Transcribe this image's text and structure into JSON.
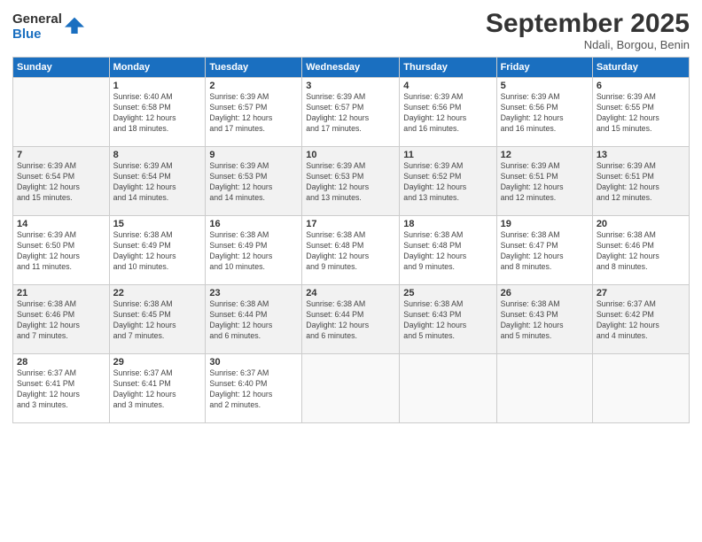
{
  "logo": {
    "general": "General",
    "blue": "Blue"
  },
  "header": {
    "month": "September 2025",
    "location": "Ndali, Borgou, Benin"
  },
  "weekdays": [
    "Sunday",
    "Monday",
    "Tuesday",
    "Wednesday",
    "Thursday",
    "Friday",
    "Saturday"
  ],
  "weeks": [
    [
      {
        "day": "",
        "info": ""
      },
      {
        "day": "1",
        "info": "Sunrise: 6:40 AM\nSunset: 6:58 PM\nDaylight: 12 hours\nand 18 minutes."
      },
      {
        "day": "2",
        "info": "Sunrise: 6:39 AM\nSunset: 6:57 PM\nDaylight: 12 hours\nand 17 minutes."
      },
      {
        "day": "3",
        "info": "Sunrise: 6:39 AM\nSunset: 6:57 PM\nDaylight: 12 hours\nand 17 minutes."
      },
      {
        "day": "4",
        "info": "Sunrise: 6:39 AM\nSunset: 6:56 PM\nDaylight: 12 hours\nand 16 minutes."
      },
      {
        "day": "5",
        "info": "Sunrise: 6:39 AM\nSunset: 6:56 PM\nDaylight: 12 hours\nand 16 minutes."
      },
      {
        "day": "6",
        "info": "Sunrise: 6:39 AM\nSunset: 6:55 PM\nDaylight: 12 hours\nand 15 minutes."
      }
    ],
    [
      {
        "day": "7",
        "info": "Sunrise: 6:39 AM\nSunset: 6:54 PM\nDaylight: 12 hours\nand 15 minutes."
      },
      {
        "day": "8",
        "info": "Sunrise: 6:39 AM\nSunset: 6:54 PM\nDaylight: 12 hours\nand 14 minutes."
      },
      {
        "day": "9",
        "info": "Sunrise: 6:39 AM\nSunset: 6:53 PM\nDaylight: 12 hours\nand 14 minutes."
      },
      {
        "day": "10",
        "info": "Sunrise: 6:39 AM\nSunset: 6:53 PM\nDaylight: 12 hours\nand 13 minutes."
      },
      {
        "day": "11",
        "info": "Sunrise: 6:39 AM\nSunset: 6:52 PM\nDaylight: 12 hours\nand 13 minutes."
      },
      {
        "day": "12",
        "info": "Sunrise: 6:39 AM\nSunset: 6:51 PM\nDaylight: 12 hours\nand 12 minutes."
      },
      {
        "day": "13",
        "info": "Sunrise: 6:39 AM\nSunset: 6:51 PM\nDaylight: 12 hours\nand 12 minutes."
      }
    ],
    [
      {
        "day": "14",
        "info": "Sunrise: 6:39 AM\nSunset: 6:50 PM\nDaylight: 12 hours\nand 11 minutes."
      },
      {
        "day": "15",
        "info": "Sunrise: 6:38 AM\nSunset: 6:49 PM\nDaylight: 12 hours\nand 10 minutes."
      },
      {
        "day": "16",
        "info": "Sunrise: 6:38 AM\nSunset: 6:49 PM\nDaylight: 12 hours\nand 10 minutes."
      },
      {
        "day": "17",
        "info": "Sunrise: 6:38 AM\nSunset: 6:48 PM\nDaylight: 12 hours\nand 9 minutes."
      },
      {
        "day": "18",
        "info": "Sunrise: 6:38 AM\nSunset: 6:48 PM\nDaylight: 12 hours\nand 9 minutes."
      },
      {
        "day": "19",
        "info": "Sunrise: 6:38 AM\nSunset: 6:47 PM\nDaylight: 12 hours\nand 8 minutes."
      },
      {
        "day": "20",
        "info": "Sunrise: 6:38 AM\nSunset: 6:46 PM\nDaylight: 12 hours\nand 8 minutes."
      }
    ],
    [
      {
        "day": "21",
        "info": "Sunrise: 6:38 AM\nSunset: 6:46 PM\nDaylight: 12 hours\nand 7 minutes."
      },
      {
        "day": "22",
        "info": "Sunrise: 6:38 AM\nSunset: 6:45 PM\nDaylight: 12 hours\nand 7 minutes."
      },
      {
        "day": "23",
        "info": "Sunrise: 6:38 AM\nSunset: 6:44 PM\nDaylight: 12 hours\nand 6 minutes."
      },
      {
        "day": "24",
        "info": "Sunrise: 6:38 AM\nSunset: 6:44 PM\nDaylight: 12 hours\nand 6 minutes."
      },
      {
        "day": "25",
        "info": "Sunrise: 6:38 AM\nSunset: 6:43 PM\nDaylight: 12 hours\nand 5 minutes."
      },
      {
        "day": "26",
        "info": "Sunrise: 6:38 AM\nSunset: 6:43 PM\nDaylight: 12 hours\nand 5 minutes."
      },
      {
        "day": "27",
        "info": "Sunrise: 6:37 AM\nSunset: 6:42 PM\nDaylight: 12 hours\nand 4 minutes."
      }
    ],
    [
      {
        "day": "28",
        "info": "Sunrise: 6:37 AM\nSunset: 6:41 PM\nDaylight: 12 hours\nand 3 minutes."
      },
      {
        "day": "29",
        "info": "Sunrise: 6:37 AM\nSunset: 6:41 PM\nDaylight: 12 hours\nand 3 minutes."
      },
      {
        "day": "30",
        "info": "Sunrise: 6:37 AM\nSunset: 6:40 PM\nDaylight: 12 hours\nand 2 minutes."
      },
      {
        "day": "",
        "info": ""
      },
      {
        "day": "",
        "info": ""
      },
      {
        "day": "",
        "info": ""
      },
      {
        "day": "",
        "info": ""
      }
    ]
  ]
}
